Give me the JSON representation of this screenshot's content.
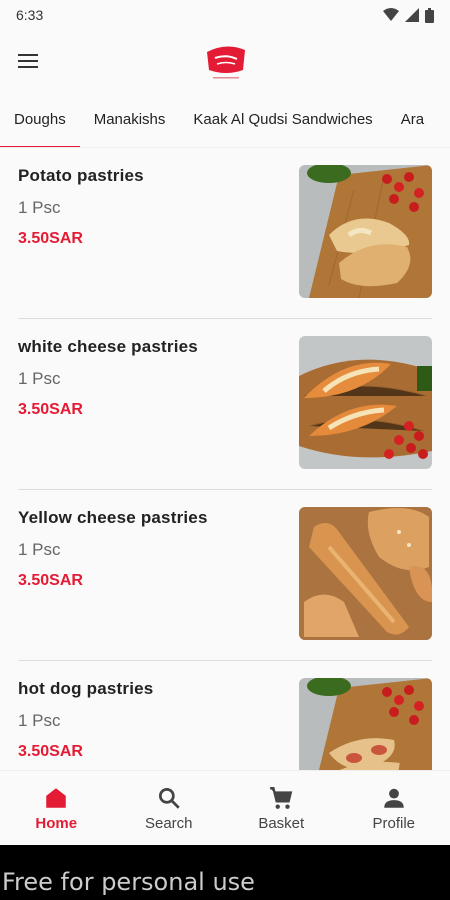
{
  "status_bar": {
    "time": "6:33"
  },
  "app": {
    "logo_name": "brand-logo"
  },
  "tabs": [
    {
      "label": "Doughs",
      "active": true
    },
    {
      "label": "Manakishs"
    },
    {
      "label": "Kaak Al Qudsi Sandwiches"
    },
    {
      "label": "Ara"
    }
  ],
  "products": [
    {
      "name": "Potato pastries",
      "qty": "1 Psc",
      "price": "3.50SAR"
    },
    {
      "name": "white cheese pastries",
      "qty": "1 Psc",
      "price": "3.50SAR"
    },
    {
      "name": "Yellow cheese pastries",
      "qty": "1 Psc",
      "price": "3.50SAR"
    },
    {
      "name": "hot dog pastries",
      "qty": "1 Psc",
      "price": "3.50SAR"
    }
  ],
  "bottom_nav": [
    {
      "label": "Home",
      "icon": "home-icon",
      "active": true
    },
    {
      "label": "Search",
      "icon": "search-icon"
    },
    {
      "label": "Basket",
      "icon": "cart-icon"
    },
    {
      "label": "Profile",
      "icon": "profile-icon"
    }
  ],
  "watermark": "Free for personal use",
  "colors": {
    "accent": "#e31b34"
  }
}
